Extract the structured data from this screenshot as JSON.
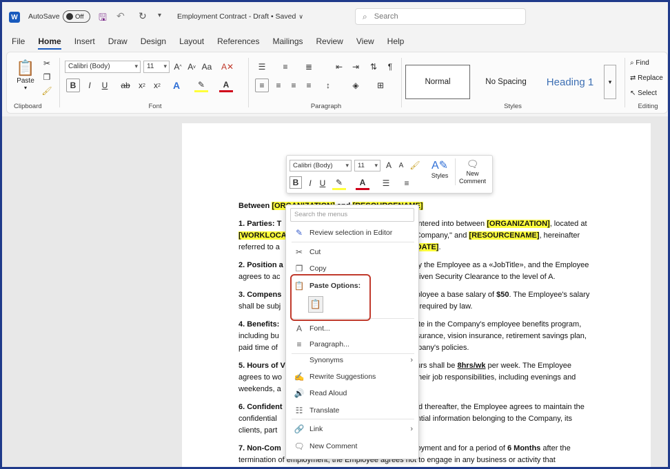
{
  "titlebar": {
    "autosave_label": "AutoSave",
    "autosave_state": "Off",
    "doc_title": "Employment Contract - Draft • Saved",
    "search_placeholder": "Search"
  },
  "menu": {
    "tabs": [
      "File",
      "Home",
      "Insert",
      "Draw",
      "Design",
      "Layout",
      "References",
      "Mailings",
      "Review",
      "View",
      "Help"
    ],
    "active": "Home"
  },
  "ribbon": {
    "clipboard": {
      "paste": "Paste",
      "label": "Clipboard"
    },
    "font": {
      "name": "Calibri (Body)",
      "size": "11",
      "label": "Font"
    },
    "paragraph": {
      "label": "Paragraph"
    },
    "styles": {
      "normal": "Normal",
      "no_spacing": "No Spacing",
      "heading1": "Heading 1",
      "label": "Styles"
    },
    "editing": {
      "find": "Find",
      "replace": "Replace",
      "select": "Select",
      "label": "Editing"
    }
  },
  "mini_toolbar": {
    "font": "Calibri (Body)",
    "size": "11",
    "styles": "Styles",
    "new_comment_1": "New",
    "new_comment_2": "Comment"
  },
  "document": {
    "between": "Between",
    "org_tag": "[ORGANIZATION]",
    "and": "and",
    "res_tag": "[RESOURCENAME]",
    "p1a": "1. Parties: T",
    "p1b": "is entered into between",
    "p1c": ", located at",
    "p1d": "[WORKLOCA",
    "p1e": "Company,\" and",
    "p1f": ", hereinafter",
    "p1g": "referred to a",
    "p1h": "RTDATE]",
    "p2a": "2. Position a",
    "p2b": "ploy the Employee as a «JobTitle», and the Employee",
    "p2c": "agrees to ac",
    "p2d": "be given Security Clearance to the level of A.",
    "p3a": "3. Compens",
    "p3b": "Employee a base salary of",
    "p3money": "$50",
    "p3c": ". The Employee's salary",
    "p3d": "shall be subj",
    "p3e": "s as required by law.",
    "p4a": "4. Benefits:",
    "p4b": "icipate in the Company's employee benefits program,",
    "p4c": "including bu",
    "p4d": "al insurance, vision insurance, retirement savings plan,",
    "p4e": "paid time of",
    "p4f": "Company's policies.",
    "p5a": "5. Hours of V",
    "p5b": "hours shall be",
    "p5hrs": "8hrs/wk",
    "p5c": "per week. The Employee",
    "p5d": "agrees to wo",
    "p5e": "lfill their job responsibilities, including evenings and",
    "p5f": "weekends, a",
    "p6a": "6. Confident",
    "p6b": "t and thereafter, the Employee agrees to maintain the",
    "p6c": "confidential",
    "p6d": "nfidential information belonging to the Company, its",
    "p6e": "clients, part",
    "p7a": "7. Non-Com",
    "p7b": "mployment and for a period of",
    "p7months": "6 Months",
    "p7c": "after the",
    "p7d": "termination of employment, the Employee agrees not to engage in any business or activity that"
  },
  "context_menu": {
    "search_placeholder": "Search the menus",
    "items": {
      "review": "Review selection in Editor",
      "cut": "Cut",
      "copy": "Copy",
      "paste_options": "Paste Options:",
      "font": "Font...",
      "paragraph": "Paragraph...",
      "synonyms": "Synonyms",
      "rewrite": "Rewrite Suggestions",
      "read_aloud": "Read Aloud",
      "translate": "Translate",
      "link": "Link",
      "new_comment": "New Comment"
    }
  },
  "colors": {
    "accent": "#185abd",
    "highlight": "#ffff3b",
    "callout": "#c0392b",
    "frame": "#1f3a8a"
  }
}
